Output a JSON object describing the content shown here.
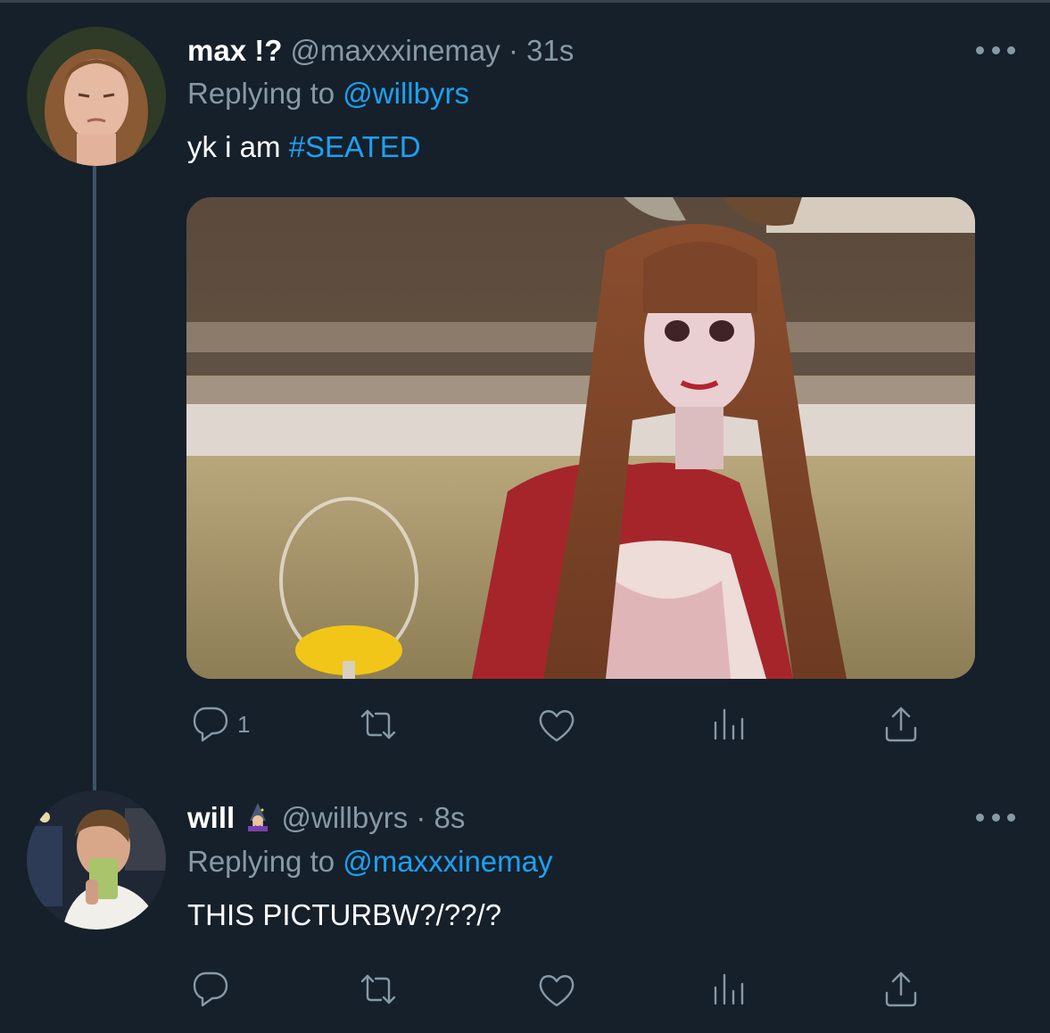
{
  "tweets": [
    {
      "display_name": "max !?",
      "handle": "@maxxxinemay",
      "separator": "·",
      "time": "31s",
      "replying_prefix": "Replying to",
      "replying_to": "@willbyrs",
      "text": "yk i am",
      "hashtag": "#SEATED",
      "reply_count": "1",
      "has_media": true
    },
    {
      "display_name": "will",
      "handle": "@willbyrs",
      "separator": "·",
      "time": "8s",
      "replying_prefix": "Replying to",
      "replying_to": "@maxxxinemay",
      "text": "THIS PICTURBW?/??/?",
      "reply_count": ""
    }
  ],
  "icons": [
    "reply-icon",
    "retweet-icon",
    "like-icon",
    "analytics-icon",
    "share-icon",
    "more-icon"
  ],
  "colors": {
    "background": "#15202b",
    "accent": "#1da1f2",
    "secondary_text": "#8899a6"
  }
}
